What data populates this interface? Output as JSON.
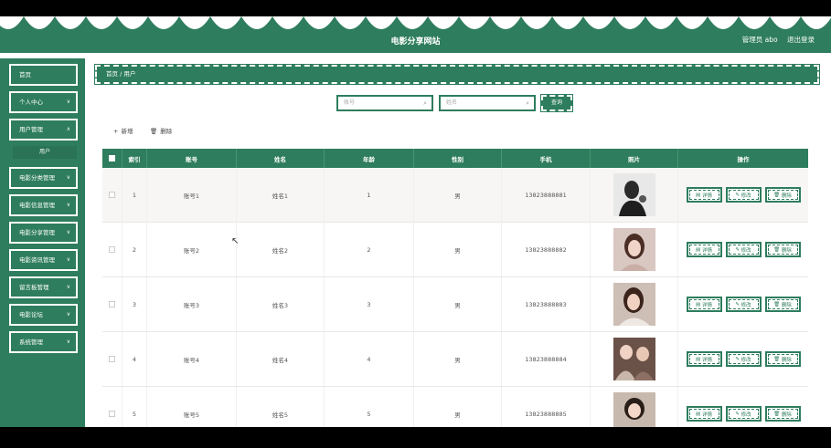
{
  "header": {
    "title": "电影分享网站",
    "user_label": "管理员 abo",
    "logout_label": "退出登录"
  },
  "sidebar": {
    "items": [
      {
        "label": "首页",
        "has_arrow": false
      },
      {
        "label": "个人中心",
        "has_arrow": true
      },
      {
        "label": "用户管理",
        "has_arrow": true
      },
      {
        "label": "电影分类管理",
        "has_arrow": true
      },
      {
        "label": "电影信息管理",
        "has_arrow": true
      },
      {
        "label": "电影分享管理",
        "has_arrow": true
      },
      {
        "label": "电影资讯管理",
        "has_arrow": true
      },
      {
        "label": "留言板管理",
        "has_arrow": true
      },
      {
        "label": "电影论坛",
        "has_arrow": true
      },
      {
        "label": "系统管理",
        "has_arrow": true
      }
    ],
    "submenu_label": "用户"
  },
  "breadcrumb": "首页 / 用户",
  "search": {
    "account_placeholder": "账号",
    "name_placeholder": "姓名",
    "button_label": "查询"
  },
  "toolbar": {
    "add_label": "新增",
    "delete_label": "删除"
  },
  "table": {
    "columns": [
      "索引",
      "账号",
      "姓名",
      "年龄",
      "性别",
      "手机",
      "照片",
      "操作"
    ],
    "rows": [
      {
        "index": "1",
        "account": "账号1",
        "name": "姓名1",
        "age": "1",
        "gender": "男",
        "phone": "13823888881"
      },
      {
        "index": "2",
        "account": "账号2",
        "name": "姓名2",
        "age": "2",
        "gender": "男",
        "phone": "13823888882"
      },
      {
        "index": "3",
        "account": "账号3",
        "name": "姓名3",
        "age": "3",
        "gender": "男",
        "phone": "13823888883"
      },
      {
        "index": "4",
        "account": "账号4",
        "name": "姓名4",
        "age": "4",
        "gender": "男",
        "phone": "13823888884"
      },
      {
        "index": "5",
        "account": "账号5",
        "name": "姓名5",
        "age": "5",
        "gender": "男",
        "phone": "13823888885"
      }
    ],
    "actions": {
      "detail": "详情",
      "edit": "修改",
      "delete": "删除"
    }
  },
  "colors": {
    "primary": "#2e7d5e",
    "background": "#ffffff"
  }
}
